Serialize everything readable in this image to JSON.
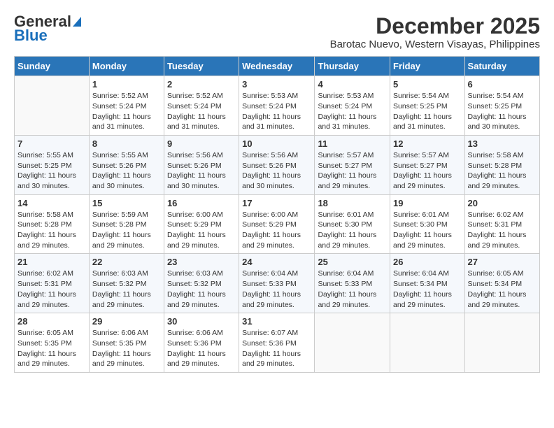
{
  "logo": {
    "text_general": "General",
    "text_blue": "Blue"
  },
  "title": "December 2025",
  "subtitle": "Barotac Nuevo, Western Visayas, Philippines",
  "weekdays": [
    "Sunday",
    "Monday",
    "Tuesday",
    "Wednesday",
    "Thursday",
    "Friday",
    "Saturday"
  ],
  "weeks": [
    [
      {
        "day": "",
        "info": ""
      },
      {
        "day": "1",
        "info": "Sunrise: 5:52 AM\nSunset: 5:24 PM\nDaylight: 11 hours\nand 31 minutes."
      },
      {
        "day": "2",
        "info": "Sunrise: 5:52 AM\nSunset: 5:24 PM\nDaylight: 11 hours\nand 31 minutes."
      },
      {
        "day": "3",
        "info": "Sunrise: 5:53 AM\nSunset: 5:24 PM\nDaylight: 11 hours\nand 31 minutes."
      },
      {
        "day": "4",
        "info": "Sunrise: 5:53 AM\nSunset: 5:24 PM\nDaylight: 11 hours\nand 31 minutes."
      },
      {
        "day": "5",
        "info": "Sunrise: 5:54 AM\nSunset: 5:25 PM\nDaylight: 11 hours\nand 31 minutes."
      },
      {
        "day": "6",
        "info": "Sunrise: 5:54 AM\nSunset: 5:25 PM\nDaylight: 11 hours\nand 30 minutes."
      }
    ],
    [
      {
        "day": "7",
        "info": "Sunrise: 5:55 AM\nSunset: 5:25 PM\nDaylight: 11 hours\nand 30 minutes."
      },
      {
        "day": "8",
        "info": "Sunrise: 5:55 AM\nSunset: 5:26 PM\nDaylight: 11 hours\nand 30 minutes."
      },
      {
        "day": "9",
        "info": "Sunrise: 5:56 AM\nSunset: 5:26 PM\nDaylight: 11 hours\nand 30 minutes."
      },
      {
        "day": "10",
        "info": "Sunrise: 5:56 AM\nSunset: 5:26 PM\nDaylight: 11 hours\nand 30 minutes."
      },
      {
        "day": "11",
        "info": "Sunrise: 5:57 AM\nSunset: 5:27 PM\nDaylight: 11 hours\nand 29 minutes."
      },
      {
        "day": "12",
        "info": "Sunrise: 5:57 AM\nSunset: 5:27 PM\nDaylight: 11 hours\nand 29 minutes."
      },
      {
        "day": "13",
        "info": "Sunrise: 5:58 AM\nSunset: 5:28 PM\nDaylight: 11 hours\nand 29 minutes."
      }
    ],
    [
      {
        "day": "14",
        "info": "Sunrise: 5:58 AM\nSunset: 5:28 PM\nDaylight: 11 hours\nand 29 minutes."
      },
      {
        "day": "15",
        "info": "Sunrise: 5:59 AM\nSunset: 5:28 PM\nDaylight: 11 hours\nand 29 minutes."
      },
      {
        "day": "16",
        "info": "Sunrise: 6:00 AM\nSunset: 5:29 PM\nDaylight: 11 hours\nand 29 minutes."
      },
      {
        "day": "17",
        "info": "Sunrise: 6:00 AM\nSunset: 5:29 PM\nDaylight: 11 hours\nand 29 minutes."
      },
      {
        "day": "18",
        "info": "Sunrise: 6:01 AM\nSunset: 5:30 PM\nDaylight: 11 hours\nand 29 minutes."
      },
      {
        "day": "19",
        "info": "Sunrise: 6:01 AM\nSunset: 5:30 PM\nDaylight: 11 hours\nand 29 minutes."
      },
      {
        "day": "20",
        "info": "Sunrise: 6:02 AM\nSunset: 5:31 PM\nDaylight: 11 hours\nand 29 minutes."
      }
    ],
    [
      {
        "day": "21",
        "info": "Sunrise: 6:02 AM\nSunset: 5:31 PM\nDaylight: 11 hours\nand 29 minutes."
      },
      {
        "day": "22",
        "info": "Sunrise: 6:03 AM\nSunset: 5:32 PM\nDaylight: 11 hours\nand 29 minutes."
      },
      {
        "day": "23",
        "info": "Sunrise: 6:03 AM\nSunset: 5:32 PM\nDaylight: 11 hours\nand 29 minutes."
      },
      {
        "day": "24",
        "info": "Sunrise: 6:04 AM\nSunset: 5:33 PM\nDaylight: 11 hours\nand 29 minutes."
      },
      {
        "day": "25",
        "info": "Sunrise: 6:04 AM\nSunset: 5:33 PM\nDaylight: 11 hours\nand 29 minutes."
      },
      {
        "day": "26",
        "info": "Sunrise: 6:04 AM\nSunset: 5:34 PM\nDaylight: 11 hours\nand 29 minutes."
      },
      {
        "day": "27",
        "info": "Sunrise: 6:05 AM\nSunset: 5:34 PM\nDaylight: 11 hours\nand 29 minutes."
      }
    ],
    [
      {
        "day": "28",
        "info": "Sunrise: 6:05 AM\nSunset: 5:35 PM\nDaylight: 11 hours\nand 29 minutes."
      },
      {
        "day": "29",
        "info": "Sunrise: 6:06 AM\nSunset: 5:35 PM\nDaylight: 11 hours\nand 29 minutes."
      },
      {
        "day": "30",
        "info": "Sunrise: 6:06 AM\nSunset: 5:36 PM\nDaylight: 11 hours\nand 29 minutes."
      },
      {
        "day": "31",
        "info": "Sunrise: 6:07 AM\nSunset: 5:36 PM\nDaylight: 11 hours\nand 29 minutes."
      },
      {
        "day": "",
        "info": ""
      },
      {
        "day": "",
        "info": ""
      },
      {
        "day": "",
        "info": ""
      }
    ]
  ]
}
